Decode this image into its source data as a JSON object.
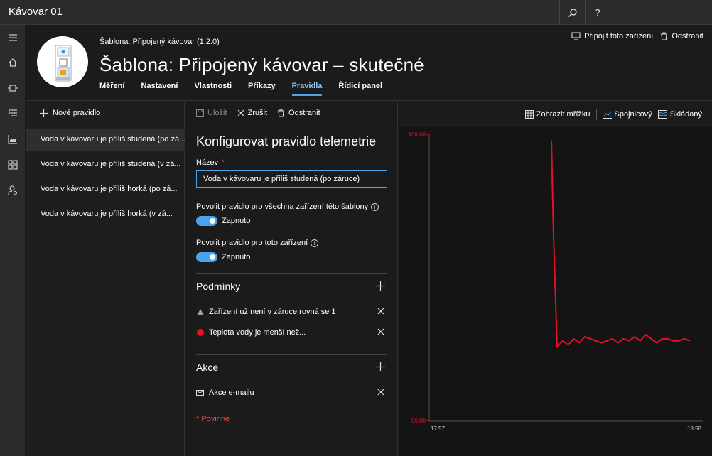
{
  "app": {
    "title": "Kávovar 01"
  },
  "topbar": {
    "search_icon": "search-icon",
    "help_label": "?"
  },
  "header": {
    "template_sub": "Šablona: Připojený kávovar  (1.2.0)",
    "title": "Šablona:  Připojený kávovar – skutečné",
    "tabs": [
      {
        "label": "Měření",
        "active": false
      },
      {
        "label": "Nastavení",
        "active": false
      },
      {
        "label": "Vlastnosti",
        "active": false
      },
      {
        "label": "Příkazy",
        "active": false
      },
      {
        "label": "Pravidla",
        "active": true
      },
      {
        "label": "Řídicí panel",
        "active": false
      }
    ],
    "actions": {
      "connect_label": "Připojit toto zařízení",
      "delete_label": "Odstranit"
    }
  },
  "rules": {
    "new_rule_label": "Nové pravidlo",
    "items": [
      {
        "label": "Voda v kávovaru je příliš studená (po zá...",
        "selected": true
      },
      {
        "label": "Voda v kávovaru je příliš studená (v zá...",
        "selected": false
      },
      {
        "label": "Voda v kávovaru je příliš horká (po zá...",
        "selected": false
      },
      {
        "label": "Voda v kávovaru je příliš horká (v zá...",
        "selected": false
      }
    ]
  },
  "config": {
    "commands": {
      "save_label": "Uložit",
      "cancel_label": "Zrušit",
      "delete_label": "Odstranit"
    },
    "title": "Konfigurovat pravidlo telemetrie",
    "name_label": "Název",
    "required_mark": "*",
    "name_value": "Voda v kávovaru je příliš studená (po záruce)",
    "enable_all_label": "Povolit pravidlo pro všechna zařízení této šablony",
    "enable_all_state": "Zapnuto",
    "enable_device_label": "Povolit pravidlo pro toto zařízení",
    "enable_device_state": "Zapnuto",
    "conditions_title": "Podmínky",
    "conditions": [
      {
        "label": "Zařízení už není v záruce rovná se 1",
        "icon": "triangle-icon",
        "color": "#a0a0a0"
      },
      {
        "label": "Teplota vody je menší než...",
        "icon": "red-dot-icon",
        "color": "#e81123"
      }
    ],
    "actions_title": "Akce",
    "actions": [
      {
        "label": "Akce e-mailu",
        "icon": "email-icon"
      }
    ],
    "required_note": "* Povinné"
  },
  "chart_toolbar": {
    "grid_label": "Zobrazit mřížku",
    "line_label": "Spojnicový",
    "stacked_label": "Skládaný"
  },
  "colors": {
    "accent": "#4aa3ee",
    "series": "#e81123"
  },
  "chart_data": {
    "type": "line",
    "ylim": [
      86,
      100
    ],
    "y_ticks": [
      "100.00",
      "86.00"
    ],
    "x_ticks": [
      "17:57",
      "18:58"
    ],
    "series": [
      {
        "values": [
          99.7,
          95.0,
          89.6,
          89.9,
          89.7,
          90.0,
          89.8,
          90.1,
          90.0,
          89.9,
          89.8,
          89.9,
          90.0,
          89.8,
          90.0,
          89.9,
          90.1,
          89.9,
          90.2,
          90.0,
          89.8,
          90.0,
          90.0,
          89.9,
          89.9,
          90.0,
          89.9
        ]
      }
    ]
  }
}
